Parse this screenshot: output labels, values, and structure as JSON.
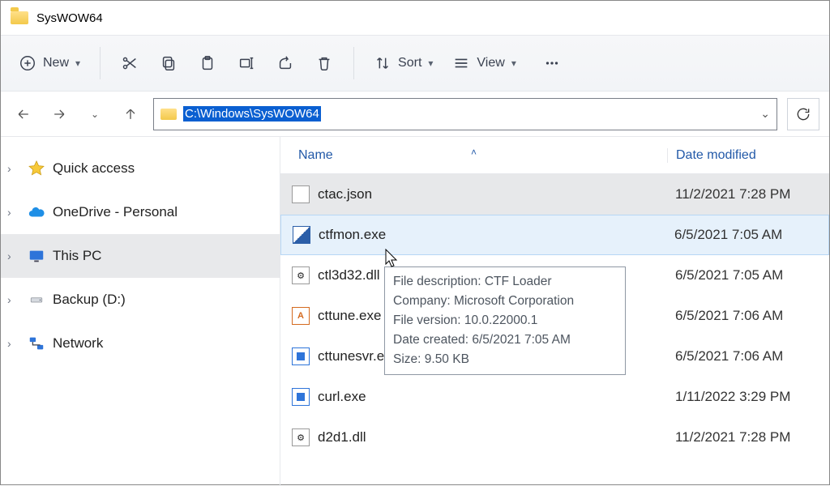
{
  "title": "SysWOW64",
  "toolbar": {
    "new": "New",
    "sort": "Sort",
    "view": "View"
  },
  "address_path": "C:\\Windows\\SysWOW64",
  "columns": {
    "name": "Name",
    "date": "Date modified"
  },
  "sidebar": [
    {
      "label": "Quick access",
      "icon": "star"
    },
    {
      "label": "OneDrive - Personal",
      "icon": "cloud"
    },
    {
      "label": "This PC",
      "icon": "monitor"
    },
    {
      "label": "Backup (D:)",
      "icon": "drive"
    },
    {
      "label": "Network",
      "icon": "network"
    }
  ],
  "files": [
    {
      "name": "ctac.json",
      "date": "11/2/2021 7:28 PM",
      "icon": "file",
      "state": "selected"
    },
    {
      "name": "ctfmon.exe",
      "date": "6/5/2021 7:05 AM",
      "icon": "edit",
      "state": "hover"
    },
    {
      "name": "ctl3d32.dll",
      "date": "6/5/2021 7:05 AM",
      "icon": "cog"
    },
    {
      "name": "cttune.exe",
      "date": "6/5/2021 7:06 AM",
      "icon": "font"
    },
    {
      "name": "cttunesvr.exe",
      "date": "6/5/2021 7:06 AM",
      "icon": "app"
    },
    {
      "name": "curl.exe",
      "date": "1/11/2022 3:29 PM",
      "icon": "app"
    },
    {
      "name": "d2d1.dll",
      "date": "11/2/2021 7:28 PM",
      "icon": "cog"
    }
  ],
  "tooltip": {
    "description": "File description: CTF Loader",
    "company": "Company: Microsoft Corporation",
    "version": "File version: 10.0.22000.1",
    "created": "Date created: 6/5/2021 7:05 AM",
    "size": "Size: 9.50 KB"
  }
}
